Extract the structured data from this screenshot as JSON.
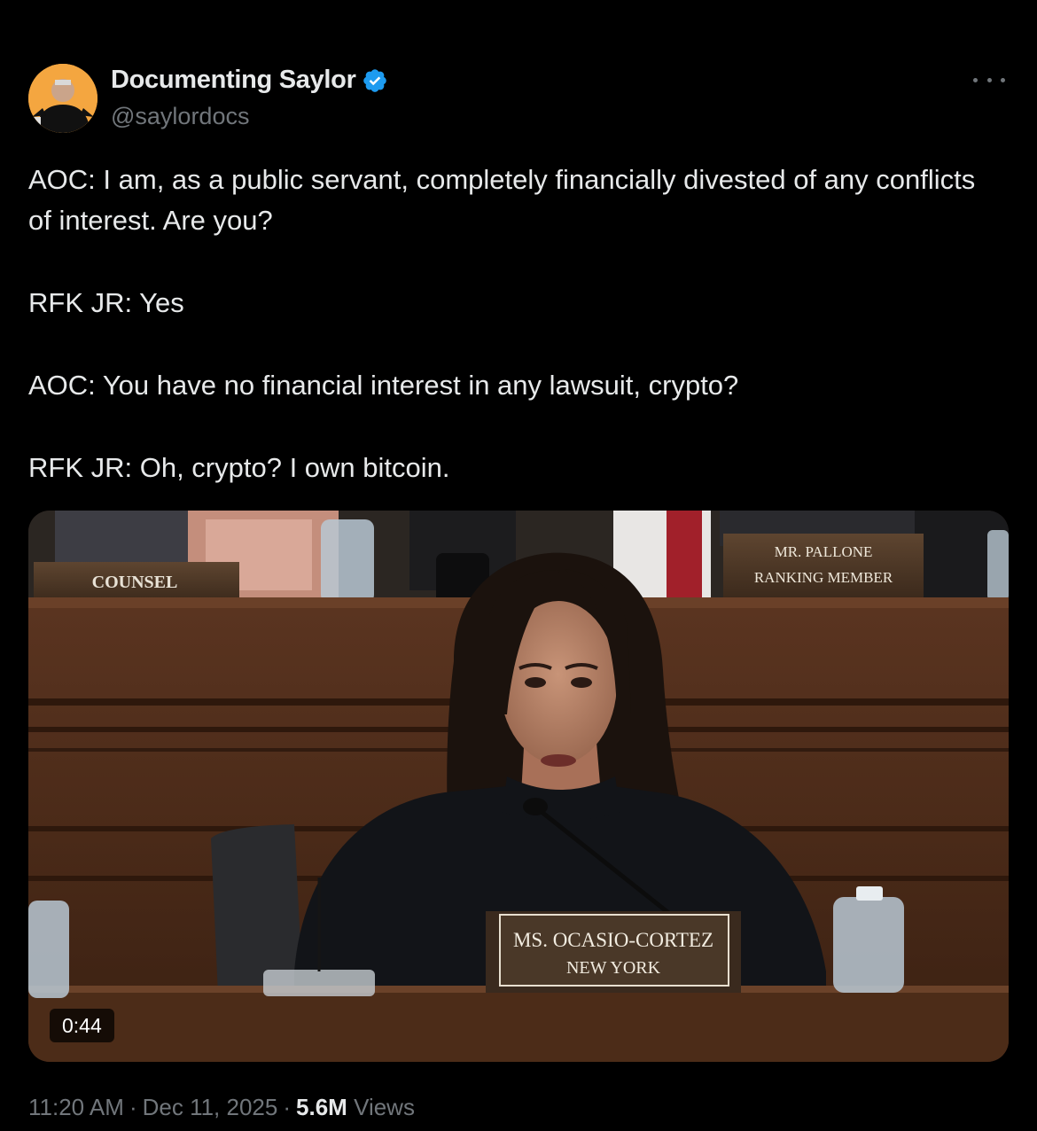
{
  "author": {
    "display_name": "Documenting Saylor",
    "handle": "@saylordocs",
    "verified": true,
    "avatar_icon": "profile-avatar",
    "verified_icon": "verified-badge-icon",
    "verified_color": "#1d9bf0"
  },
  "more_icon": "more-options-icon",
  "tweet": {
    "lines": [
      "AOC: I am, as a public servant, completely financially divested of any conflicts of interest. Are you?",
      "RFK JR: Yes",
      "AOC: You have no financial interest in any lawsuit, crypto?",
      "RFK JR: Oh, crypto? I own bitcoin."
    ]
  },
  "media": {
    "type": "video",
    "duration": "0:44",
    "placards": {
      "counsel": "COUNSEL",
      "ranking_line1": "MR. PALLONE",
      "ranking_line2": "RANKING MEMBER",
      "nameplate_line1": "MS. OCASIO-CORTEZ",
      "nameplate_line2": "NEW YORK"
    }
  },
  "meta": {
    "time": "11:20 AM",
    "separator": "·",
    "date": "Dec 11, 2025",
    "views_count": "5.6M",
    "views_label": "Views"
  },
  "colors": {
    "background": "#000000",
    "text_primary": "#e7e9ea",
    "text_secondary": "#71767b",
    "accent": "#1d9bf0"
  }
}
